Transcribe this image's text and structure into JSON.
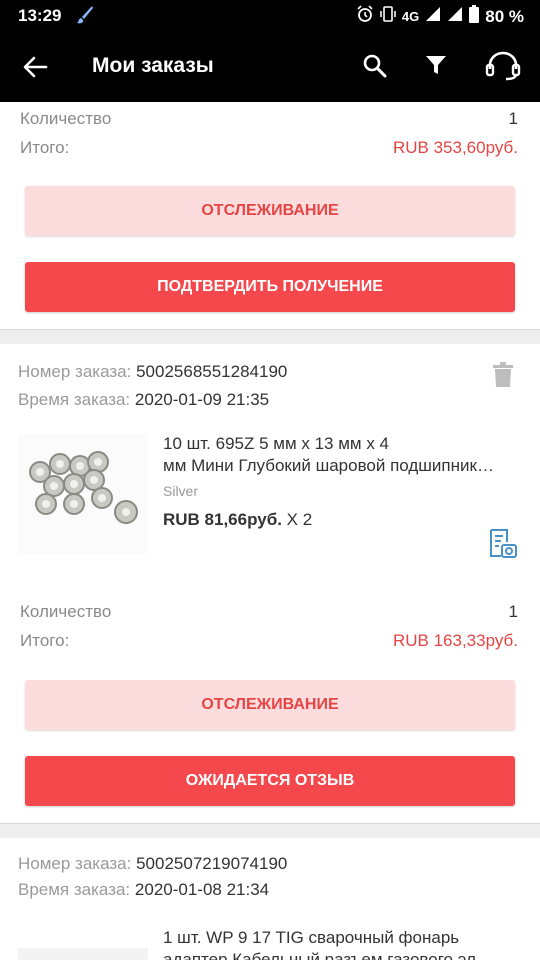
{
  "status_bar": {
    "time": "13:29",
    "network": "4G",
    "battery": "80 %"
  },
  "app_bar": {
    "title": "Мои заказы"
  },
  "orders": [
    {
      "quantity_label": "Количество",
      "quantity": "1",
      "total_label": "Итого:",
      "total": "RUB 353,60руб.",
      "track_label": "ОТСЛЕЖИВАНИЕ",
      "action_label": "ПОДТВЕРДИТЬ ПОЛУЧЕНИЕ"
    },
    {
      "order_no_label": "Номер заказа:",
      "order_no": "5002568551284190",
      "order_time_label": "Время заказа:",
      "order_time": "2020-01-09 21:35",
      "product_line1": "10 шт. 695Z 5 мм x 13 мм x 4",
      "product_line2": "мм Мини Глубокий шаровой подшипник…",
      "variant": "Silver",
      "price": "RUB 81,66руб.",
      "qty_mult": "X 2",
      "quantity_label": "Количество",
      "quantity": "1",
      "total_label": "Итого:",
      "total": "RUB 163,33руб.",
      "track_label": "ОТСЛЕЖИВАНИЕ",
      "action_label": "ОЖИДАЕТСЯ ОТЗЫВ"
    },
    {
      "order_no_label": "Номер заказа:",
      "order_no": "5002507219074190",
      "order_time_label": "Время заказа:",
      "order_time": "2020-01-08 21:34",
      "product_line1": "1 шт. WP 9 17 TIG сварочный фонарь",
      "product_line2": "адаптер Кабельный разъем газового эл"
    }
  ],
  "colors": {
    "accent": "#f5484d",
    "accent_light": "#fcdcdc",
    "price_red": "#e64545",
    "icon_blue": "#4a90c8"
  },
  "icons": [
    "back-arrow-icon",
    "search-icon",
    "filter-icon",
    "support-headset-icon",
    "trash-icon",
    "snapshot-icon"
  ]
}
